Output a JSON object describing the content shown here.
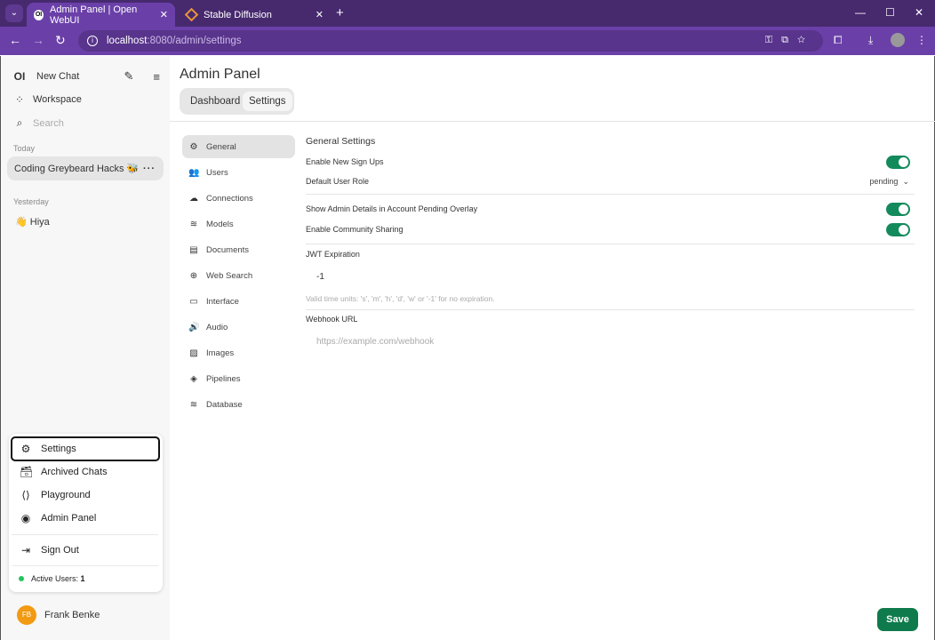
{
  "browser": {
    "tabs": [
      {
        "title": "Admin Panel | Open WebUI",
        "favicon": "OI"
      },
      {
        "title": "Stable Diffusion"
      }
    ],
    "url_host": "localhost",
    "url_path": ":8080/admin/settings"
  },
  "sidebar": {
    "logo": "OI",
    "new_chat": "New Chat",
    "workspace": "Workspace",
    "search_placeholder": "Search",
    "sections": [
      {
        "label": "Today",
        "chats": [
          "Coding Greybeard Hacks 🐝"
        ]
      },
      {
        "label": "Yesterday",
        "chats": [
          "👋 Hiya"
        ]
      }
    ],
    "menu": {
      "items": [
        "Settings",
        "Archived Chats",
        "Playground",
        "Admin Panel"
      ],
      "sign_out": "Sign Out",
      "active_users_label": "Active Users:",
      "active_users_count": "1"
    },
    "user": {
      "initials": "FB",
      "name": "Frank Benke"
    }
  },
  "main": {
    "title": "Admin Panel",
    "tabs": [
      "Dashboard",
      "Settings"
    ],
    "active_tab": "Settings",
    "settings_nav": [
      "General",
      "Users",
      "Connections",
      "Models",
      "Documents",
      "Web Search",
      "Interface",
      "Audio",
      "Images",
      "Pipelines",
      "Database"
    ],
    "general": {
      "heading": "General Settings",
      "enable_signups": {
        "label": "Enable New Sign Ups",
        "on": true
      },
      "default_role": {
        "label": "Default User Role",
        "value": "pending"
      },
      "show_admin": {
        "label": "Show Admin Details in Account Pending Overlay",
        "on": true
      },
      "community": {
        "label": "Enable Community Sharing",
        "on": true
      },
      "jwt": {
        "label": "JWT Expiration",
        "value": "-1",
        "hint": "Valid time units: 's', 'm', 'h', 'd', 'w' or '-1' for no expiration."
      },
      "webhook": {
        "label": "Webhook URL",
        "placeholder": "https://example.com/webhook"
      }
    },
    "save": "Save"
  },
  "colors": {
    "accent": "#138a5c",
    "browser": "#6a40a8"
  }
}
